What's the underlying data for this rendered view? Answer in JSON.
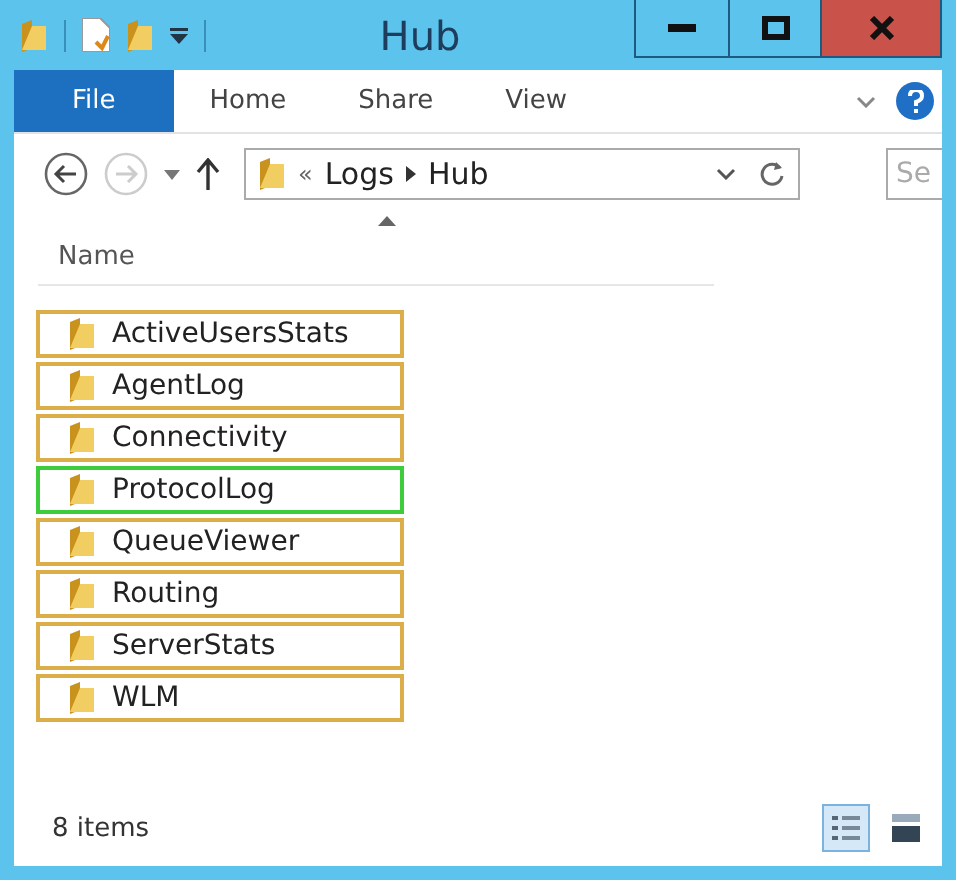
{
  "window": {
    "title": "Hub"
  },
  "ribbon": {
    "tabs": [
      {
        "label": "File",
        "kind": "file"
      },
      {
        "label": "Home",
        "kind": "tab"
      },
      {
        "label": "Share",
        "kind": "tab"
      },
      {
        "label": "View",
        "kind": "tab"
      }
    ]
  },
  "address_bar": {
    "overflow": "«",
    "path": [
      "Logs",
      "Hub"
    ]
  },
  "search": {
    "placeholder": "Se"
  },
  "columns": [
    {
      "label": "Name"
    }
  ],
  "items": [
    {
      "name": "ActiveUsersStats",
      "color": "#dcae4a"
    },
    {
      "name": "AgentLog",
      "color": "#dcae4a"
    },
    {
      "name": "Connectivity",
      "color": "#dcae4a"
    },
    {
      "name": "ProtocolLog",
      "color": "#3ccc3c"
    },
    {
      "name": "QueueViewer",
      "color": "#dcae4a"
    },
    {
      "name": "Routing",
      "color": "#dcae4a"
    },
    {
      "name": "ServerStats",
      "color": "#dcae4a"
    },
    {
      "name": "WLM",
      "color": "#dcae4a"
    }
  ],
  "status_bar": {
    "count": "8 items"
  },
  "view_buttons": [
    {
      "kind": "details",
      "selected": true
    },
    {
      "kind": "large",
      "selected": false
    }
  ]
}
